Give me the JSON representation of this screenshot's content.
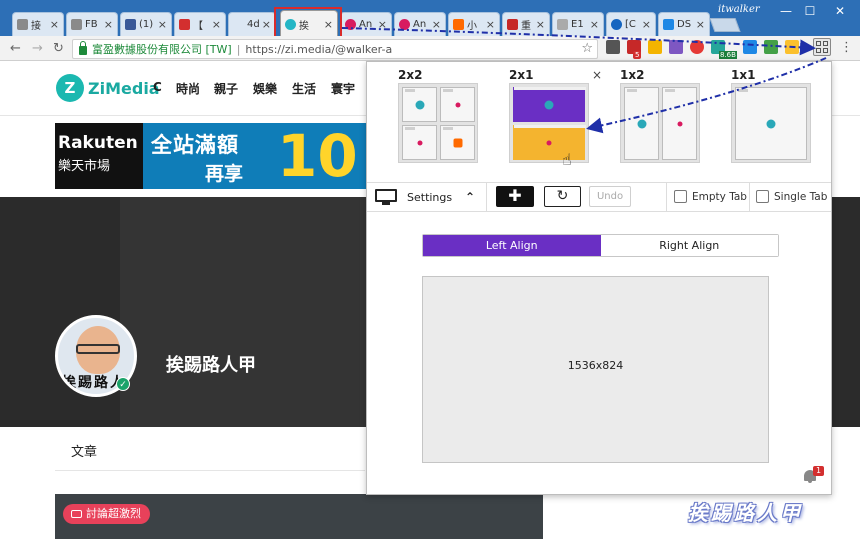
{
  "browser": {
    "tabs": [
      {
        "title": "接",
        "favicon_color": "#8a8a8a"
      },
      {
        "title": "FB",
        "favicon_color": "#8a8a8a"
      },
      {
        "title": "(1)",
        "favicon_color": "#3b5998"
      },
      {
        "title": "【",
        "favicon_color": "#d32f2f"
      },
      {
        "title": "4d",
        "favicon_color": "#dce7f3"
      },
      {
        "title": "挨",
        "favicon_color": "#25b6c5",
        "active": true
      },
      {
        "title": "An",
        "favicon_color": "#d81b60"
      },
      {
        "title": "An",
        "favicon_color": "#d81b60"
      },
      {
        "title": "小",
        "favicon_color": "#ff6a00"
      },
      {
        "title": "重",
        "favicon_color": "#c62828"
      },
      {
        "title": "E1",
        "favicon_color": "#aaaaaa"
      },
      {
        "title": "[C",
        "favicon_color": "#1565c0"
      },
      {
        "title": "DS",
        "favicon_color": "#1e88e5"
      }
    ],
    "profile_name": "itwalker",
    "window_controls": {
      "minimize": "—",
      "maximize": "☐",
      "close": "✕"
    },
    "omnibox": {
      "cert_name": "富盈數據股份有限公司 [TW]",
      "separator": "|",
      "url": "https://zi.media/@walker-a"
    },
    "extension_badges": {
      "gmail_count": "5",
      "download_count": "8.6B"
    },
    "icons": [
      "back-arrow-icon",
      "forward-arrow-icon",
      "reload-icon",
      "lock-icon",
      "star-icon",
      "tab-resizer-icon",
      "chrome-menu-icon"
    ]
  },
  "site": {
    "logo": "ZiMedia",
    "logo_mark": "Z",
    "nav": [
      "C",
      "時尚",
      "親子",
      "娛樂",
      "生活",
      "寰宇"
    ],
    "ad": {
      "brand_en": "Rakuten",
      "brand_zh": "樂天市場",
      "line1": "全站滿額",
      "line2": "再享",
      "big": "10"
    },
    "profile": {
      "name": "挨踢路人甲",
      "avatar_caption": "挨踢路人甲",
      "verified_icon": "✓"
    },
    "tab_articles": "文章",
    "discuss_badge": "討論超激烈",
    "watermark": "挨踢路人甲"
  },
  "popup": {
    "layouts": [
      {
        "label": "2x2"
      },
      {
        "label": "2x1",
        "selected": true
      },
      {
        "label": "1x2"
      },
      {
        "label": "1x1"
      }
    ],
    "close_symbol": "×",
    "controls": {
      "settings_label": "Settings",
      "collapse_symbol": "⌃",
      "add_symbol": "✚",
      "refresh_symbol": "↻",
      "undo_label": "Undo",
      "empty_tab_label": "Empty Tab",
      "single_tab_label": "Single Tab"
    },
    "align": {
      "left": "Left Align",
      "right": "Right Align",
      "selected": "left"
    },
    "screen_resolution": "1536x824",
    "notification_count": "1"
  },
  "colors": {
    "tabstrip": "#2d6fb6",
    "accent_purple": "#6a2fc4",
    "accent_orange": "#f4b42f",
    "highlight_red": "#d92b2b",
    "arrow_blue": "#1f2fa8",
    "zimedia_teal": "#1bb8b0"
  }
}
